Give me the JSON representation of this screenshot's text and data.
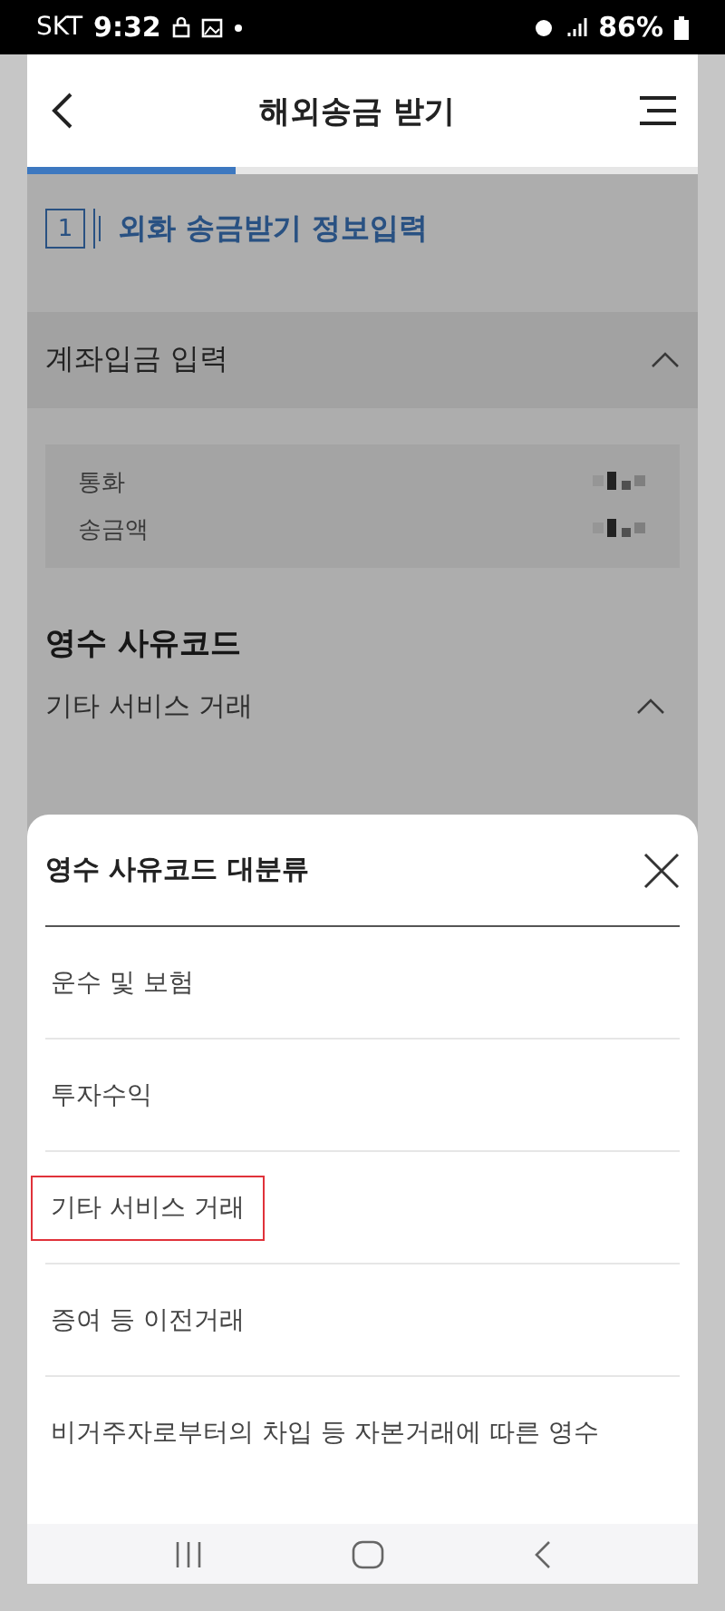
{
  "status_bar": {
    "carrier": "SKT",
    "time": "9:32",
    "battery": "86%"
  },
  "header": {
    "title": "해외송금 받기"
  },
  "progress": {
    "level": 0.31
  },
  "step": {
    "number": "1",
    "title": "외화 송금받기 정보입력"
  },
  "section": {
    "title": "계좌입금 입력",
    "expanded": true,
    "fields": [
      {
        "label": "통화",
        "redacted": true
      },
      {
        "label": "송금액",
        "redacted": true
      }
    ]
  },
  "reason_code": {
    "title": "영수 사유코드",
    "value": "기타 서비스 거래",
    "expanded": true
  },
  "sheet": {
    "title": "영수 사유코드 대분류",
    "options": [
      {
        "label": "운수 및 보험",
        "highlighted": false
      },
      {
        "label": "투자수익",
        "highlighted": false
      },
      {
        "label": "기타 서비스 거래",
        "highlighted": true
      },
      {
        "label": "증여 등 이전거래",
        "highlighted": false
      },
      {
        "label": "비거주자로부터의 차입 등 자본거래에 따른 영수",
        "highlighted": false
      }
    ]
  }
}
